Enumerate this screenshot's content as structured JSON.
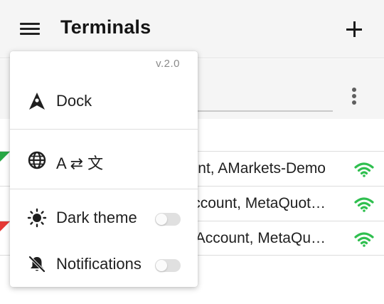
{
  "appbar": {
    "title": "Terminals",
    "menu_icon": "hamburger-menu-icon",
    "add_icon": "plus-icon"
  },
  "search": {
    "more_icon": "more-vertical-icon"
  },
  "terminals": [
    {
      "label": "nt, AMarkets-Demo",
      "status_icon": "wifi-icon",
      "status_color": "#2fbf4f"
    },
    {
      "label": "ccount, MetaQuot…",
      "status_icon": "wifi-icon",
      "status_color": "#2fbf4f"
    },
    {
      "label": "Account, MetaQu…",
      "status_icon": "wifi-icon",
      "status_color": "#2fbf4f"
    }
  ],
  "menu": {
    "version": "v.2.0",
    "items": [
      {
        "label": "Dock",
        "icon": "dock-icon"
      },
      {
        "label": "A ⇄ 文",
        "icon": "globe-icon"
      },
      {
        "label": "Dark theme",
        "icon": "sun-icon",
        "toggle": false
      },
      {
        "label": "Notifications",
        "icon": "notifications-off-icon",
        "toggle": false
      }
    ]
  },
  "colors": {
    "online": "#2fbf4f",
    "indicator_green": "#27a744",
    "indicator_red": "#e53935"
  }
}
